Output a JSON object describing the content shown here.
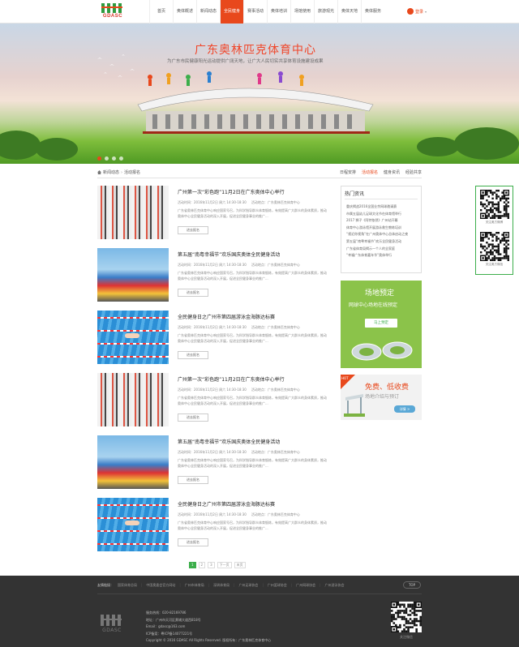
{
  "header": {
    "logo_text": "GDASC",
    "nav": [
      "首页",
      "奥体概述",
      "新闻动态",
      "全民健身",
      "赛事活动",
      "奥体培训",
      "场馆使用",
      "旅游观光",
      "奥体天地",
      "奥体服务"
    ],
    "nav_active_index": 3,
    "login_label": "登录"
  },
  "banner": {
    "title": "广东奥林匹克体育中心",
    "subtitle": "为广东市民健康阳光运动提供广阔天地，让广大人民切实共享体育设施建设成果",
    "slide_count": 4,
    "active_slide": 0
  },
  "breadcrumb": {
    "items": [
      "新闻动态",
      "活动报名"
    ],
    "separator": " › "
  },
  "subtabs": {
    "items": [
      "日程安排",
      "活动报名",
      "健身资讯",
      "经验共享"
    ],
    "active_index": 1
  },
  "articles": [
    {
      "title": "广州第一次“彩色跑”11月2日在广东奥体中心举行",
      "time_label": "活动时间：2016年11月2日 周六 14:30-18:30",
      "place_label": "活动地点：广东奥林匹克体育中心",
      "desc": "广东省奥林匹克体育中心响应国家号召，为科学指导群众体育锻炼，有效提高广大群众的身体素质，推动奥体中心全民健身活动的深入开展，促进全民健身事业的推广...",
      "button": "进去报名",
      "thumb": "crowd"
    },
    {
      "title": "第五届“南粤幸福节”欢乐国庆奥体全民健身活动",
      "time_label": "活动时间：2016年11月2日 周六 14:30-18:30",
      "place_label": "活动地点：广东奥林匹克体育中心",
      "desc": "广东省奥林匹克体育中心响应国家号召，为科学指导群众体育锻炼，有效提高广大群众的身体素质，推动奥体中心全民健身活动的深入开展，促进全民健身事业的推广...",
      "button": "进去报名",
      "thumb": "build"
    },
    {
      "title": "全民健身日之广州市第四届游泳金海豚达标赛",
      "time_label": "活动时间：2016年11月2日 周六 14:30-18:30",
      "place_label": "活动地点：广东奥林匹克体育中心",
      "desc": "广东省奥林匹克体育中心响应国家号召，为科学指导群众体育锻炼，有效提高广大群众的身体素质，推动奥体中心全民健身活动的深入开展，促进全民健身事业的推广...",
      "button": "进去报名",
      "thumb": "pool"
    },
    {
      "title": "广州第一次“彩色跑”11月2日在广东奥体中心举行",
      "time_label": "活动时间：2016年11月2日 周六 14:30-18:30",
      "place_label": "活动地点：广东奥林匹克体育中心",
      "desc": "广东省奥林匹克体育中心响应国家号召，为科学指导群众体育锻炼，有效提高广大群众的身体素质，推动奥体中心全民健身活动的深入开展，促进全民健身事业的推广...",
      "button": "进去报名",
      "thumb": "crowd"
    },
    {
      "title": "第五届“南粤幸福节”欢乐国庆奥体全民健身活动",
      "time_label": "活动时间：2016年11月2日 周六 14:30-18:30",
      "place_label": "活动地点：广东奥林匹克体育中心",
      "desc": "广东省奥林匹克体育中心响应国家号召，为科学指导群众体育锻炼，有效提高广大群众的身体素质，推动奥体中心全民健身活动的深入开展，促进全民健身事业的推广...",
      "button": "进去报名",
      "thumb": "build"
    },
    {
      "title": "全民健身日之广州市第四届游泳金海豚达标赛",
      "time_label": "活动时间：2016年11月2日 周六 14:30-18:30",
      "place_label": "活动地点：广东奥林匹克体育中心",
      "desc": "广东省奥林匹克体育中心响应国家号召，为科学指导群众体育锻炼，有效提高广大群众的身体素质，推动奥体中心全民健身活动的深入开展，促进全民健身事业的推广...",
      "button": "进去报名",
      "thumb": "pool"
    }
  ],
  "pagination": {
    "pages": [
      "1",
      "2",
      "3",
      "下一页",
      "末页"
    ],
    "active_index": 0
  },
  "sidebar": {
    "hot_title": "热门资讯",
    "hot_items": [
      "重庆揭战2016全国业余网球邀请赛",
      "市属五届幼儿足球文化节在体育馆举行",
      "2017 狮子《阿特依然》广州站开幕",
      "体育中心游泳馆开展游泳救生教练培训",
      "“视近你视角”在广州奥体中心总体启动之夜",
      "第五届“南粤幸福节”欢乐全民健身活动",
      "广东省体育局揭示一个人的全家庭",
      "“幸福广东体育嘉年华”奥体举行"
    ],
    "booking": {
      "title": "场地预定",
      "subtitle": "网球中心场地在线预定",
      "button": "马上预定"
    },
    "promo": {
      "tag": "HOT",
      "title": "免费、低收费",
      "subtitle": "场地介绍与预订",
      "button": "详情 >"
    }
  },
  "qr_float": {
    "caption1": "关注奥方微博",
    "caption2": "关注奥方微信"
  },
  "footer": {
    "links_label": "友情链接：",
    "links": [
      "国家体育总局",
      "中国奥委会官方网站",
      "广州市体育局",
      "深圳体育局",
      "广州足球协会",
      "广州篮球协会",
      "广州网球协会",
      "广州游泳协会"
    ],
    "top_label": "TOP",
    "logo_text": "GDASC",
    "info": [
      "服务热线：020-82169786",
      "地址：广州市天河区黄埔大道西818号",
      "Email：gdasc@163.com",
      "ICP备案：粤ICP备14077221号",
      "Copyright © 2016 GDASC All Rights Reserved.    版权所有：广东奥林匹克体育中心"
    ],
    "qr_caption": "关注微信"
  },
  "colors": {
    "accent": "#e8481c",
    "green": "#3cae4b",
    "footer_bg": "#333333"
  },
  "icons": [
    "user-icon",
    "home-icon",
    "qr-code-icon"
  ]
}
